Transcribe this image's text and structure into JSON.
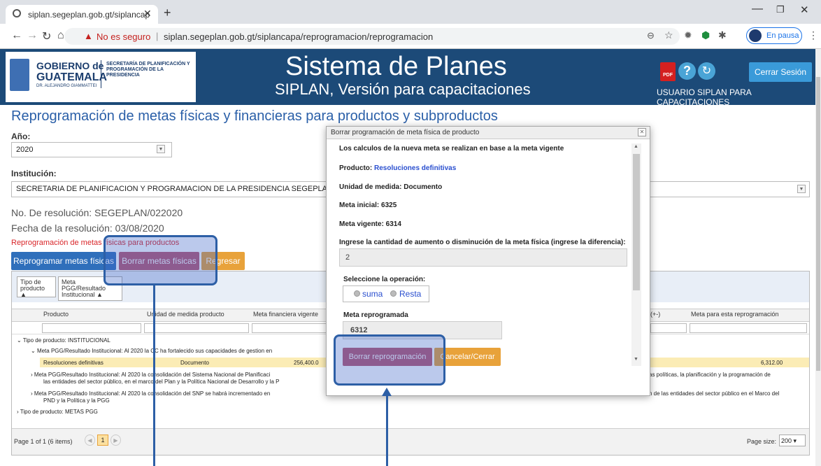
{
  "browser": {
    "tab_title": "siplan.segeplan.gob.gt/siplancap",
    "insecure_label": "No es seguro",
    "url": "siplan.segeplan.gob.gt/siplancapa/reprogramacion/reprogramacion",
    "profile_label": "En pausa"
  },
  "header": {
    "logo_line1": "GOBIERNO de",
    "logo_line2": "GUATEMALA",
    "logo_small": "DR. ALEJANDRO GIAMMATTEI",
    "logo_secretaria": "SECRETARÍA DE PLANIFICACIÓN Y PROGRAMACIÓN DE LA PRESIDENCIA",
    "title": "Sistema de Planes",
    "subtitle": "SIPLAN, Versión para capacitaciones",
    "logout_label": "Cerrar Sesión",
    "user_label": "USUARIO SIPLAN PARA CAPACITACIONES",
    "pdf_label": "PDF"
  },
  "page": {
    "title": "Reprogramación de metas físicas y financieras para productos y subproductos",
    "year_label": "Año:",
    "year_value": "2020",
    "institution_label": "Institución:",
    "institution_value": "SECRETARIA DE PLANIFICACION Y PROGRAMACION DE LA PRESIDENCIA SEGEPLAN",
    "resolution": "No. De resolución: SEGEPLAN/022020",
    "resolution_date": "Fecha de la resolución: 03/08/2020",
    "reprog_section": "Reprogramación de metas físicas para productos",
    "btn_reprog": "Reprogramar metas físicas",
    "btn_borrar": "Borrar metas físicas",
    "btn_regresar": "Regresar"
  },
  "grid": {
    "group_chips": [
      "Tipo de producto",
      "Meta PGG/Resultado Institucional"
    ],
    "columns": [
      "Producto",
      "Unidad de medida producto",
      "Meta financiera vigente",
      "(+-)",
      "Meta para esta reprogramación"
    ],
    "rows": [
      "Tipo de producto: INSTITUCIONAL",
      "Meta PGG/Resultado Institucional: Al 2020 la CC ha fortalecido sus capacidades de gestion en",
      "Meta PGG/Resultado Institucional: Al 2020 la consolidación del Sistema Nacional de Planificaci",
      "las entidades del sector público, en el marco del Plan y la Política Nacional de Desarrollo y la P",
      "Meta PGG/Resultado Institucional: Al 2020 la consolidación del SNP se habrá incrementado en",
      "PND y la Política y la PGG",
      "Tipo de producto: METAS PGG"
    ],
    "highlight_row": {
      "producto": "Resoluciones definitivas",
      "unidad": "Documento",
      "meta_financiera": "256,400.0",
      "meta_reprog": "6,312.00"
    },
    "right_text1": "as políticas, la planificación y la programación de",
    "right_text2": "n de las entidades del sector público en el Marco del",
    "pager_text": "Page 1 of 1 (6 items)",
    "current_page": "1",
    "page_size_label": "Page size:",
    "page_size": "200"
  },
  "dialog": {
    "title": "Borrar programación de meta física de producto",
    "note": "Los calculos de la nueva meta se realizan en base a la meta vigente",
    "producto_label": "Producto:",
    "producto_value": "Resoluciones definitivas",
    "unidad": "Unidad de medida: Documento",
    "meta_inicial": "Meta inicial: 6325",
    "meta_vigente": "Meta vigente: 6314",
    "instruction": "Ingrese la cantidad de aumento o disminución de la meta física (ingrese la diferencia):",
    "diff_value": "2",
    "operation_label": "Seleccione la operación:",
    "op_suma": "suma",
    "op_resta": "Resta",
    "result_label": "Meta reprogramada",
    "result_value": "6312",
    "btn_borrar": "Borrar reprogramación",
    "btn_cancelar": "Cancelar/Cerrar"
  },
  "colors": {
    "header_bg": "#1c4a78",
    "title_blue": "#2a5fa8",
    "btn_blue": "#2f6fbb",
    "btn_rose": "#b85670",
    "btn_orange": "#e8a23a",
    "highlight": "#2d5fa6"
  }
}
